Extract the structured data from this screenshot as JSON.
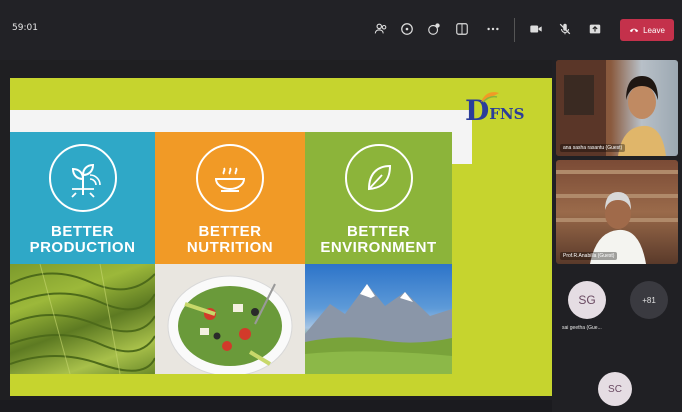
{
  "toolbar": {
    "timer": "59:01",
    "leave_label": "Leave",
    "icons": [
      "people-icon",
      "chat-icon",
      "react-icon",
      "rooms-icon",
      "more-icon",
      "camera-icon",
      "mic-off-icon",
      "share-icon"
    ]
  },
  "slide": {
    "logo_letter": "D",
    "logo_text": "FNS",
    "columns": [
      {
        "title_line1": "BETTER",
        "title_line2": "PRODUCTION",
        "color": "#2fa8c7",
        "icon": "plant-tech-icon"
      },
      {
        "title_line1": "BETTER",
        "title_line2": "NUTRITION",
        "color": "#f19a26",
        "icon": "hot-bowl-icon"
      },
      {
        "title_line1": "BETTER",
        "title_line2": "ENVIRONMENT",
        "color": "#8cb43a",
        "icon": "leaf-icon"
      }
    ],
    "background_color": "#c6d42e"
  },
  "participants": {
    "tile1_name": "ana sasha rasantu (Guest)",
    "tile2_name": "Prof.R.Anabilla (Guest)",
    "sg_initials": "SG",
    "sg_name": "sai geetha (Gue...",
    "more_label": "+81",
    "sc_initials": "SC"
  },
  "colors": {
    "leave": "#c4314b",
    "toolbar": "#222226"
  }
}
